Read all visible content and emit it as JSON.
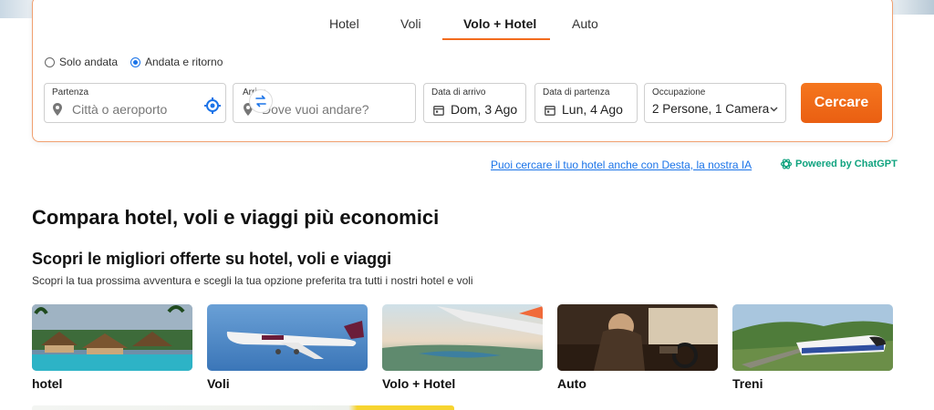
{
  "tabs": [
    "Hotel",
    "Voli",
    "Volo + Hotel",
    "Auto"
  ],
  "active_tab": "Volo + Hotel",
  "trip_type": {
    "one_way": "Solo andata",
    "round_trip": "Andata e ritorno",
    "selected": "Andata e ritorno"
  },
  "departure": {
    "label": "Partenza",
    "placeholder": "Città o aeroporto"
  },
  "arrival": {
    "label": "Arrivo",
    "placeholder": "Dove vuoi andare?"
  },
  "checkin": {
    "label": "Data di arrivo",
    "value": "Dom, 3 Ago"
  },
  "checkout": {
    "label": "Data di partenza",
    "value": "Lun, 4 Ago"
  },
  "occupancy": {
    "label": "Occupazione",
    "value": "2 Persone, 1 Camera"
  },
  "search_button": "Cercare",
  "desta_link": "Puoi cercare il tuo hotel anche con Desta, la nostra IA",
  "powered_by": "Powered by ChatGPT",
  "heading_main": "Compara hotel, voli e viaggi più economici",
  "heading_offers": "Scopri le migliori offerte su hotel, voli e viaggi",
  "subheading": "Scopri la tua prossima avventura e scegli la tua opzione preferita tra tutti i nostri hotel e voli",
  "categories": [
    "hotel",
    "Voli",
    "Volo + Hotel",
    "Auto",
    "Treni"
  ],
  "colors": {
    "accent": "#f26b1d",
    "link": "#1a73e8",
    "chatgpt": "#10a37f"
  },
  "icons": [
    "location-pin-icon",
    "geolocate-icon",
    "swap-icon",
    "calendar-icon",
    "chevron-down-icon",
    "openai-icon"
  ]
}
